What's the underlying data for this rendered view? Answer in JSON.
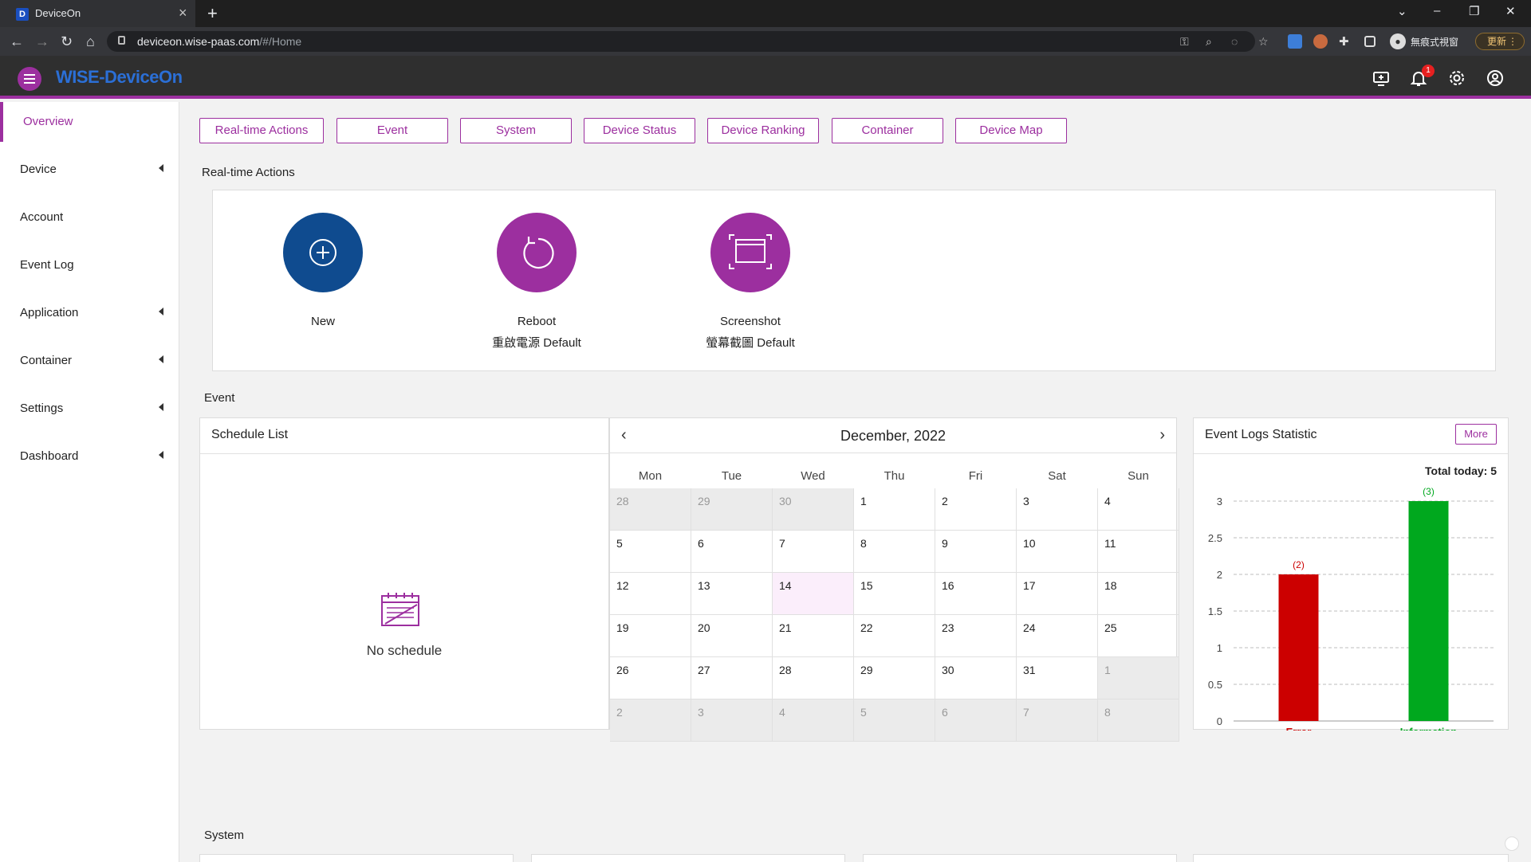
{
  "browser": {
    "tab_title": "DeviceOn",
    "tab_favicon": "D",
    "url_host": "deviceon.wise-paas.com",
    "url_path": "/#/Home",
    "profile_label": "無痕式視窗",
    "update_label": "更新"
  },
  "header": {
    "brand": "WISE-DeviceOn",
    "notification_count": "1",
    "accent_color": "#9c2f9f"
  },
  "sidebar": {
    "items": [
      {
        "label": "Overview",
        "active": true
      },
      {
        "label": "Device"
      },
      {
        "label": "Account"
      },
      {
        "label": "Event Log"
      },
      {
        "label": "Application"
      },
      {
        "label": "Container"
      },
      {
        "label": "Settings"
      },
      {
        "label": "Dashboard"
      }
    ]
  },
  "quick_nav": [
    "Real-time Actions",
    "Event",
    "System",
    "Device Status",
    "Device Ranking",
    "Container",
    "Device Map"
  ],
  "realtime": {
    "title": "Real-time Actions",
    "actions": [
      {
        "name": "New",
        "sub": "",
        "icon": "plus-circle-icon",
        "color": "#0f4b8f"
      },
      {
        "name": "Reboot",
        "sub": "重啟電源 Default",
        "icon": "reboot-icon",
        "color": "#9c2f9f"
      },
      {
        "name": "Screenshot",
        "sub": "螢幕截圖 Default",
        "icon": "screenshot-icon",
        "color": "#9c2f9f"
      }
    ]
  },
  "event": {
    "title": "Event",
    "schedule": {
      "title": "Schedule List",
      "empty": "No schedule"
    },
    "calendar": {
      "month": "December, 2022",
      "weekdays": [
        "Mon",
        "Tue",
        "Wed",
        "Thu",
        "Fri",
        "Sat",
        "Sun"
      ],
      "weeks": [
        [
          "28",
          "29",
          "30",
          "1",
          "2",
          "3",
          "4"
        ],
        [
          "5",
          "6",
          "7",
          "8",
          "9",
          "10",
          "11"
        ],
        [
          "12",
          "13",
          "14",
          "15",
          "16",
          "17",
          "18"
        ],
        [
          "19",
          "20",
          "21",
          "22",
          "23",
          "24",
          "25"
        ],
        [
          "26",
          "27",
          "28",
          "29",
          "30",
          "31",
          "1"
        ],
        [
          "2",
          "3",
          "4",
          "5",
          "6",
          "7",
          "8"
        ]
      ]
    },
    "stats": {
      "title": "Event Logs Statistic",
      "more": "More",
      "total": "Total today: 5"
    }
  },
  "system": {
    "title": "System"
  },
  "chart_data": {
    "type": "bar",
    "categories": [
      "Error",
      "Information"
    ],
    "values": [
      2,
      3
    ],
    "data_labels": [
      "(2)",
      "(3)"
    ],
    "colors": [
      "#cc0000",
      "#00a81e"
    ],
    "ylim": [
      0,
      3
    ],
    "yticks": [
      "0",
      "0.5",
      "1",
      "1.5",
      "2",
      "2.5",
      "3"
    ],
    "grid": true
  }
}
